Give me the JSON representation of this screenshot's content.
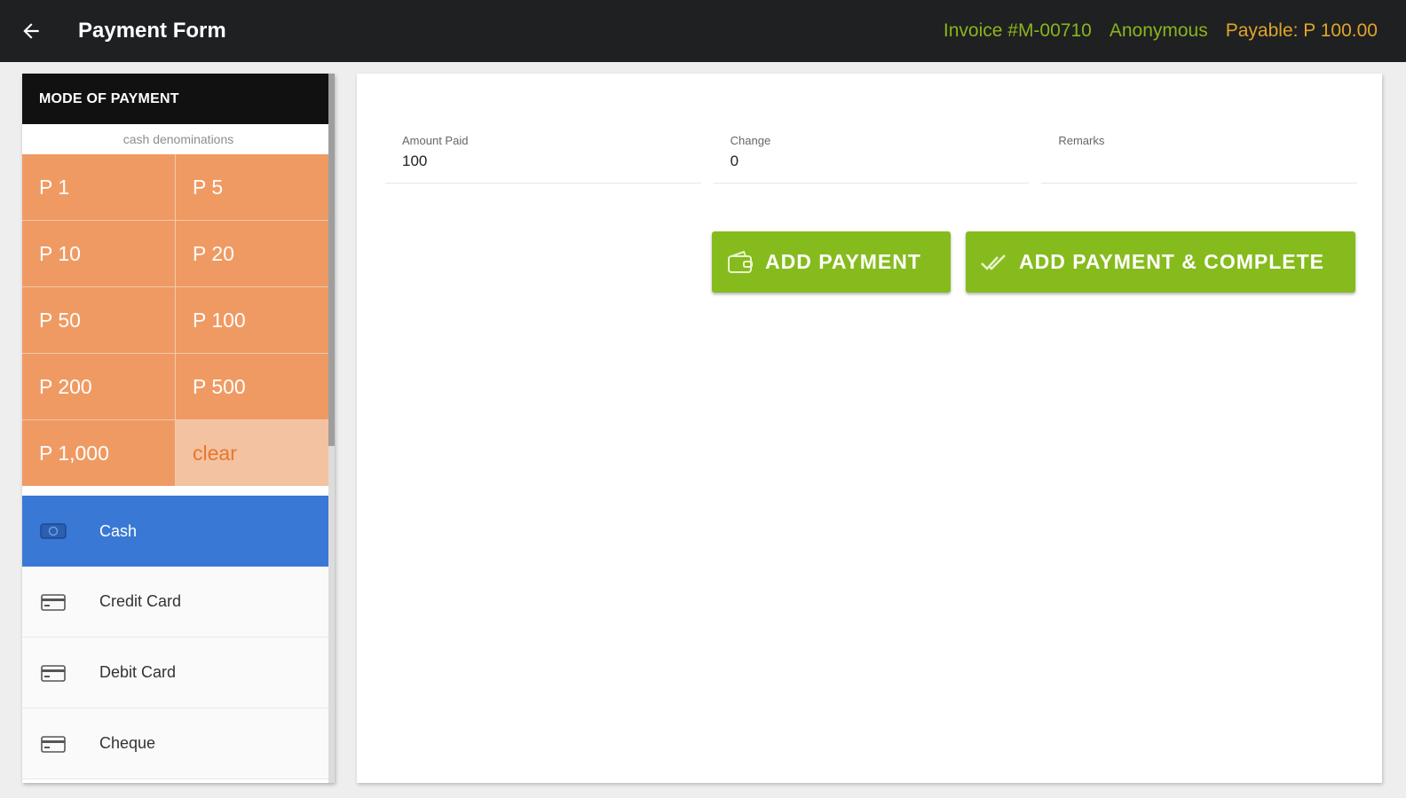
{
  "header": {
    "title": "Payment Form",
    "invoice": "Invoice #M-00710",
    "customer": "Anonymous",
    "payable": "Payable: P 100.00",
    "colors": {
      "bar": "#1f2021",
      "invoice": "#8bb31d",
      "payable": "#e0a52a"
    }
  },
  "mode_panel": {
    "title": "MODE OF PAYMENT",
    "denominations_caption": "cash denominations",
    "denominations": [
      "P 1",
      "P 5",
      "P 10",
      "P 20",
      "P 50",
      "P 100",
      "P 200",
      "P 500",
      "P 1,000"
    ],
    "clear_label": "clear",
    "modes": [
      {
        "label": "Cash",
        "icon": "cash-icon",
        "active": true
      },
      {
        "label": "Credit Card",
        "icon": "credit-card-icon",
        "active": false
      },
      {
        "label": "Debit Card",
        "icon": "debit-card-icon",
        "active": false
      },
      {
        "label": "Cheque",
        "icon": "cheque-icon",
        "active": false
      }
    ],
    "colors": {
      "denomination": "#f09a63",
      "active_mode": "#3a78d6"
    }
  },
  "form": {
    "amount_paid": {
      "label": "Amount Paid",
      "value": "100"
    },
    "change": {
      "label": "Change",
      "value": "0"
    },
    "remarks": {
      "label": "Remarks",
      "value": ""
    }
  },
  "actions": {
    "add_payment": "ADD PAYMENT",
    "add_payment_complete": "ADD PAYMENT & COMPLETE",
    "color": "#86bb1d"
  }
}
